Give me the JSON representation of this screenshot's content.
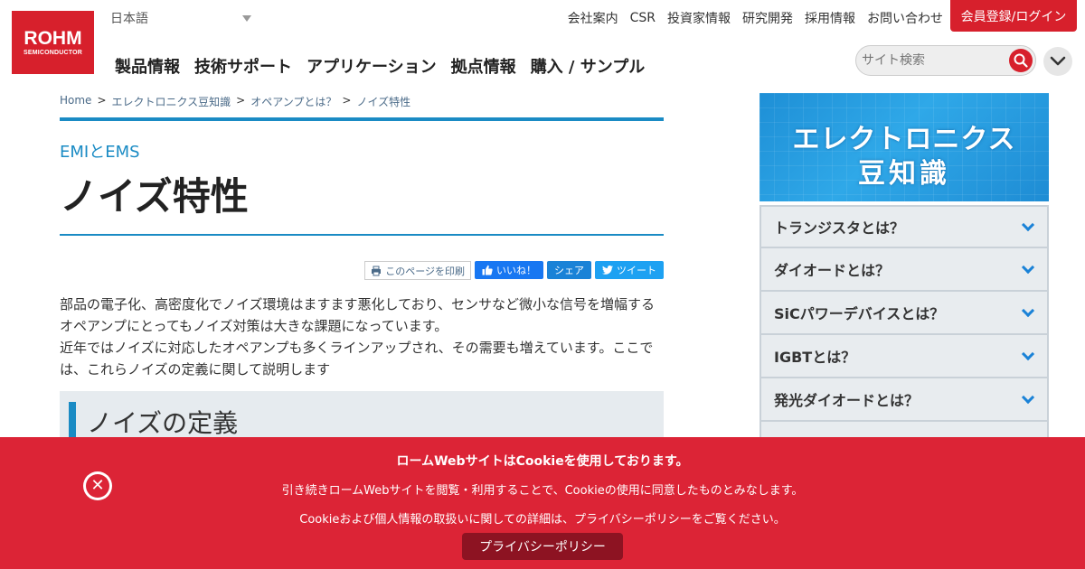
{
  "header": {
    "logo": {
      "name": "ROHM",
      "sub": "SEMICONDUCTOR"
    },
    "language": "日本語",
    "util_nav": [
      "会社案内",
      "CSR",
      "投資家情報",
      "研究開発",
      "採用情報",
      "お問い合わせ"
    ],
    "member_button": "会員登録/ログイン",
    "main_nav": [
      "製品情報",
      "技術サポート",
      "アプリケーション",
      "拠点情報",
      "購入 / サンプル"
    ],
    "search_placeholder": "サイト検索"
  },
  "breadcrumb": [
    "Home",
    "エレクトロニクス豆知識",
    "オペアンプとは？",
    "ノイズ特性"
  ],
  "breadcrumb_sep": ">",
  "article": {
    "subtitle": "EMIとEMS",
    "title": "ノイズ特性",
    "share": {
      "print": "このページを印刷",
      "like": "いいね！",
      "share": "シェア",
      "tweet": "ツイート"
    },
    "paragraphs": [
      "部品の電子化、高密度化でノイズ環境はますます悪化しており、センサなど微小な信号を増幅するオペアンプにとってもノイズ対策は大きな課題になっています。",
      "近年ではノイズに対応したオペアンプも多くラインアップされ、その需要も増えています。ここでは、これらノイズの定義に関して説明します"
    ],
    "section_heading": "ノイズの定義"
  },
  "sidebar": {
    "banner_line1": "エレクトロニクス",
    "banner_line2": "豆知識",
    "items": [
      "トランジスタとは？",
      "ダイオードとは？",
      "SiCパワーデバイスとは？",
      "IGBTとは？",
      "発光ダイオードとは？",
      ""
    ]
  },
  "cookie": {
    "heading": "ロームWebサイトはCookieを使用しております。",
    "line1": "引き続きロームWebサイトを閲覧・利用することで、Cookieの使用に同意したものとみなします。",
    "line2": "Cookieおよび個人情報の取扱いに関しての詳細は、プライバシーポリシーをご覧ください。",
    "button": "プライバシーポリシー"
  },
  "colors": {
    "brand_red": "#d7202c",
    "accent_blue": "#1a8bc4",
    "cookie_bg": "#dc2436"
  }
}
